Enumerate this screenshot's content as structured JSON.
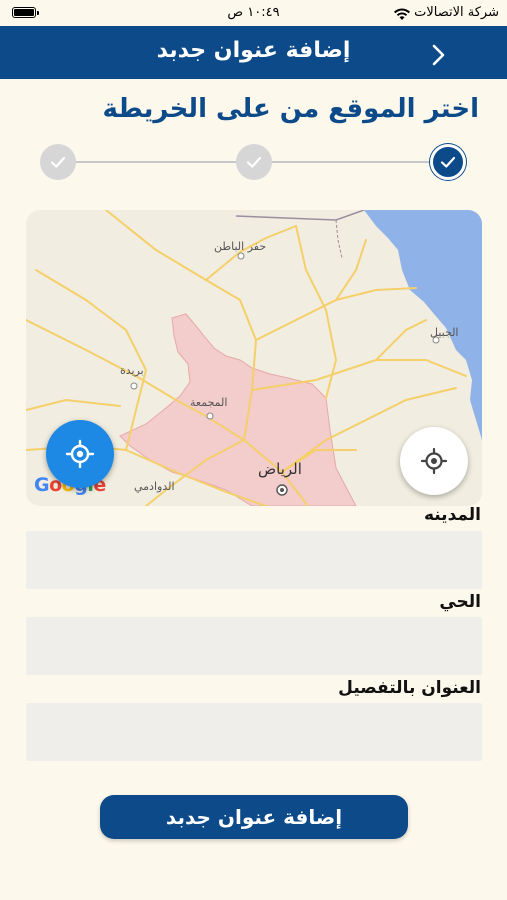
{
  "status_bar": {
    "carrier": "شركة الاتصالات",
    "time": "١٠:٤٩ ص"
  },
  "header": {
    "title": "إضافة عنوان جدبد"
  },
  "step_title": "اختر الموقع من على الخريطة",
  "stepper": {
    "steps": [
      {
        "state": "inactive"
      },
      {
        "state": "inactive"
      },
      {
        "state": "active"
      }
    ]
  },
  "map": {
    "labels": {
      "hafr": "حفر الباطن",
      "jubail": "الجبيل",
      "buraydah": "بريدة",
      "majmaah": "المجمعة",
      "riyadh": "الرياض",
      "dawadmi": "الدوادمي"
    },
    "google": [
      "G",
      "o",
      "o",
      "g",
      "l",
      "e"
    ],
    "colors": {
      "sea": "#8fb3e8",
      "region": "#f3cccc",
      "road": "#f5cf6a"
    }
  },
  "form": {
    "city_label": "المدينه",
    "district_label": "الحي",
    "address_label": "العنوان بالتفصيل",
    "city_value": "",
    "district_value": "",
    "address_value": ""
  },
  "submit_label": "إضافة عنوان جدبد"
}
